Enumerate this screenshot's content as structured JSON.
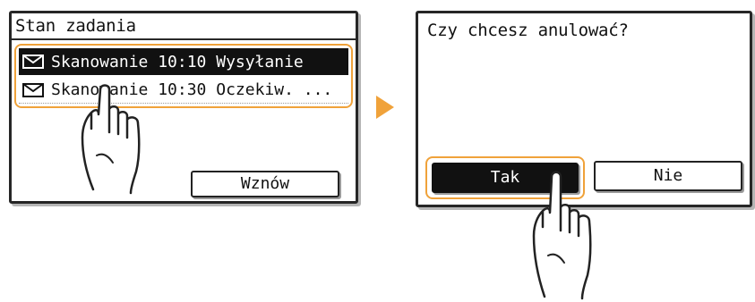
{
  "left_screen": {
    "title": "Stan zadania",
    "jobs": [
      {
        "icon": "envelope-icon",
        "text": "Skanowanie 10:10 Wysyłanie",
        "selected": true
      },
      {
        "icon": "envelope-icon",
        "text": "Skanowanie 10:30 Oczekiw. ...",
        "selected": false
      }
    ],
    "resume_label": "Wznów"
  },
  "right_screen": {
    "question": "Czy chcesz anulować?",
    "yes_label": "Tak",
    "no_label": "Nie"
  },
  "colors": {
    "highlight": "#f0a23a",
    "arrow": "#f0a23a",
    "selected_bg": "#111111"
  }
}
